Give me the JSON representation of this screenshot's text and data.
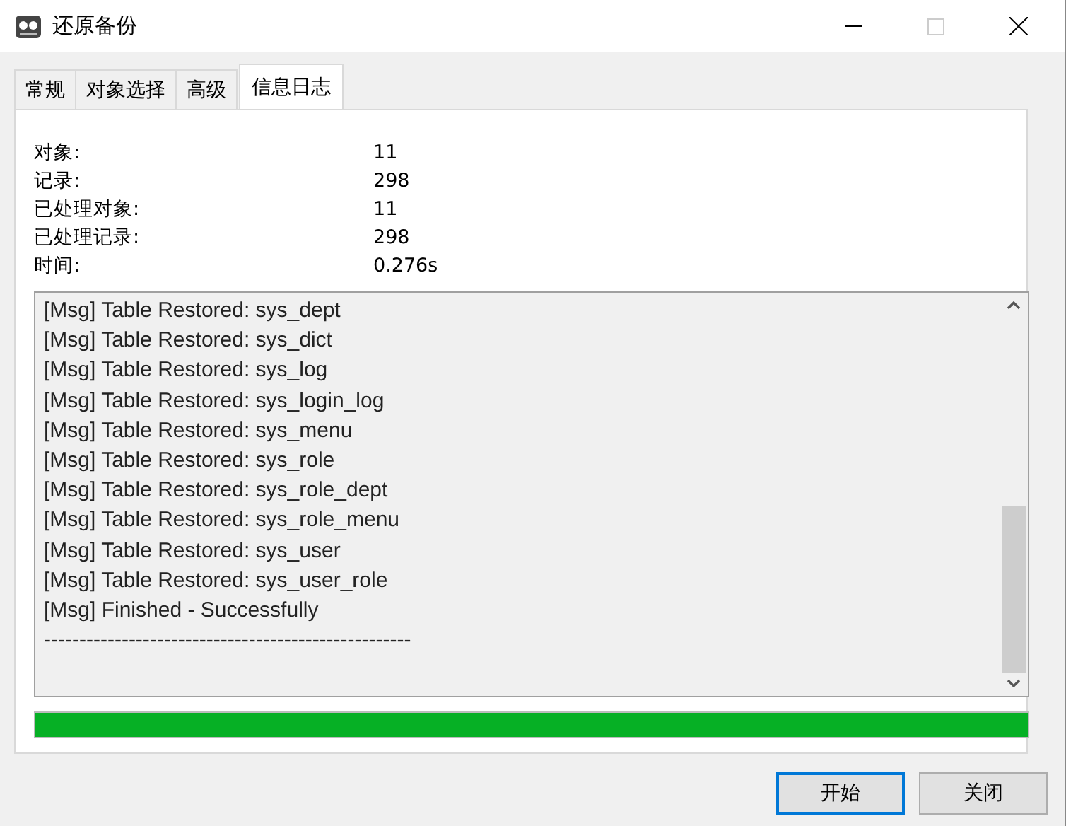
{
  "window": {
    "title": "还原备份"
  },
  "tabs": [
    {
      "label": "常规",
      "selected": false
    },
    {
      "label": "对象选择",
      "selected": false
    },
    {
      "label": "高级",
      "selected": false
    },
    {
      "label": "信息日志",
      "selected": true
    }
  ],
  "stats": [
    {
      "label": "对象:",
      "value": "11"
    },
    {
      "label": "记录:",
      "value": "298"
    },
    {
      "label": "已处理对象:",
      "value": "11"
    },
    {
      "label": "已处理记录:",
      "value": "298"
    },
    {
      "label": "时间:",
      "value": "0.276s"
    }
  ],
  "log": [
    "[Msg] Table Restored: sys_dept",
    "[Msg] Table Restored: sys_dict",
    "[Msg] Table Restored: sys_log",
    "[Msg] Table Restored: sys_login_log",
    "[Msg] Table Restored: sys_menu",
    "[Msg] Table Restored: sys_role",
    "[Msg] Table Restored: sys_role_dept",
    "[Msg] Table Restored: sys_role_menu",
    "[Msg] Table Restored: sys_user",
    "[Msg] Table Restored: sys_user_role",
    "[Msg] Finished - Successfully",
    "----------------------------------------------------"
  ],
  "progress": {
    "level": 1
  },
  "buttons": [
    {
      "label": "开始",
      "selected": true
    },
    {
      "label": "关闭",
      "selected": false
    }
  ]
}
